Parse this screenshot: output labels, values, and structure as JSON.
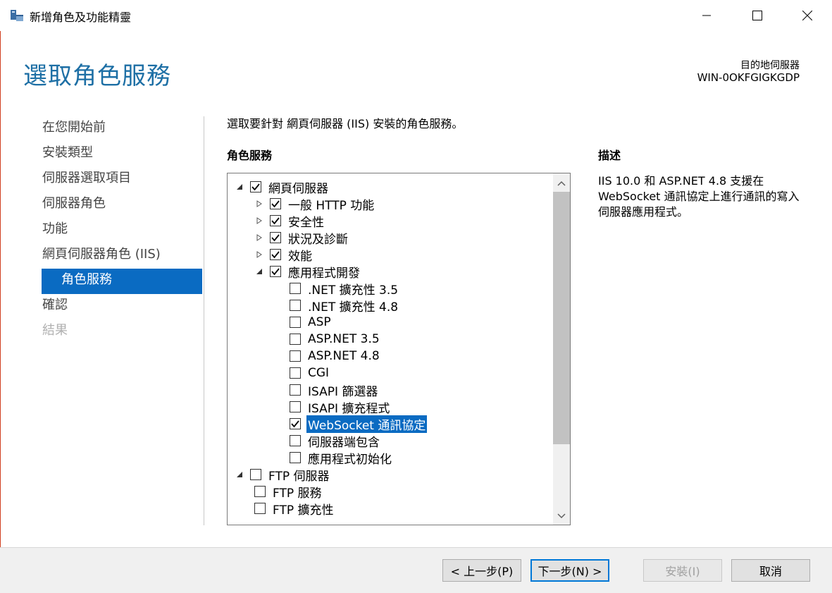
{
  "window": {
    "title": "新增角色及功能精靈",
    "minimize": "minimize",
    "maximize": "maximize",
    "close": "close"
  },
  "header": {
    "page_title": "選取角色服務",
    "dest_label": "目的地伺服器",
    "dest_server": "WIN-0OKFGIGKGDP"
  },
  "nav": {
    "items": [
      {
        "label": "在您開始前",
        "state": "normal"
      },
      {
        "label": "安裝類型",
        "state": "normal"
      },
      {
        "label": "伺服器選取項目",
        "state": "normal"
      },
      {
        "label": "伺服器角色",
        "state": "normal"
      },
      {
        "label": "功能",
        "state": "normal"
      },
      {
        "label": "網頁伺服器角色 (IIS)",
        "state": "normal"
      },
      {
        "label": "角色服務",
        "state": "active"
      },
      {
        "label": "確認",
        "state": "normal"
      },
      {
        "label": "結果",
        "state": "disabled"
      }
    ]
  },
  "main": {
    "instruction": "選取要針對 網頁伺服器 (IIS) 安裝的角色服務。",
    "role_services_heading": "角色服務",
    "description_heading": "描述",
    "description_text": "IIS 10.0 和 ASP.NET 4.8 支援在 WebSocket 通訊協定上進行通訊的寫入伺服器應用程式。",
    "tree": [
      {
        "label": "網頁伺服器",
        "level": 0,
        "expander": "expanded",
        "checked": true
      },
      {
        "label": "一般 HTTP 功能",
        "level": 1,
        "expander": "collapsed",
        "checked": true
      },
      {
        "label": "安全性",
        "level": 1,
        "expander": "collapsed",
        "checked": true
      },
      {
        "label": "狀況及診斷",
        "level": 1,
        "expander": "collapsed",
        "checked": true
      },
      {
        "label": "效能",
        "level": 1,
        "expander": "collapsed",
        "checked": true
      },
      {
        "label": "應用程式開發",
        "level": 1,
        "expander": "expanded",
        "checked": true
      },
      {
        "label": ".NET 擴充性 3.5",
        "level": 2,
        "expander": "none",
        "checked": false
      },
      {
        "label": ".NET 擴充性 4.8",
        "level": 2,
        "expander": "none",
        "checked": false
      },
      {
        "label": "ASP",
        "level": 2,
        "expander": "none",
        "checked": false
      },
      {
        "label": "ASP.NET 3.5",
        "level": 2,
        "expander": "none",
        "checked": false
      },
      {
        "label": "ASP.NET 4.8",
        "level": 2,
        "expander": "none",
        "checked": false
      },
      {
        "label": "CGI",
        "level": 2,
        "expander": "none",
        "checked": false
      },
      {
        "label": "ISAPI 篩選器",
        "level": 2,
        "expander": "none",
        "checked": false
      },
      {
        "label": "ISAPI 擴充程式",
        "level": 2,
        "expander": "none",
        "checked": false
      },
      {
        "label": "WebSocket 通訊協定",
        "level": 2,
        "expander": "none",
        "checked": true,
        "selected": true
      },
      {
        "label": "伺服器端包含",
        "level": 2,
        "expander": "none",
        "checked": false
      },
      {
        "label": "應用程式初始化",
        "level": 2,
        "expander": "none",
        "checked": false
      },
      {
        "label": "FTP 伺服器",
        "level": 0,
        "expander": "expanded",
        "checked": false
      },
      {
        "label": "FTP 服務",
        "level": 1,
        "expander": "none",
        "checked": false
      },
      {
        "label": "FTP 擴充性",
        "level": 1,
        "expander": "none",
        "checked": false
      }
    ]
  },
  "footer": {
    "prev_label": "< 上一步(P)",
    "next_label": "下一步(N) >",
    "install_label": "安裝(I)",
    "cancel_label": "取消"
  },
  "colors": {
    "accent": "#0a6bc2",
    "title_blue": "#1d6fa5"
  }
}
